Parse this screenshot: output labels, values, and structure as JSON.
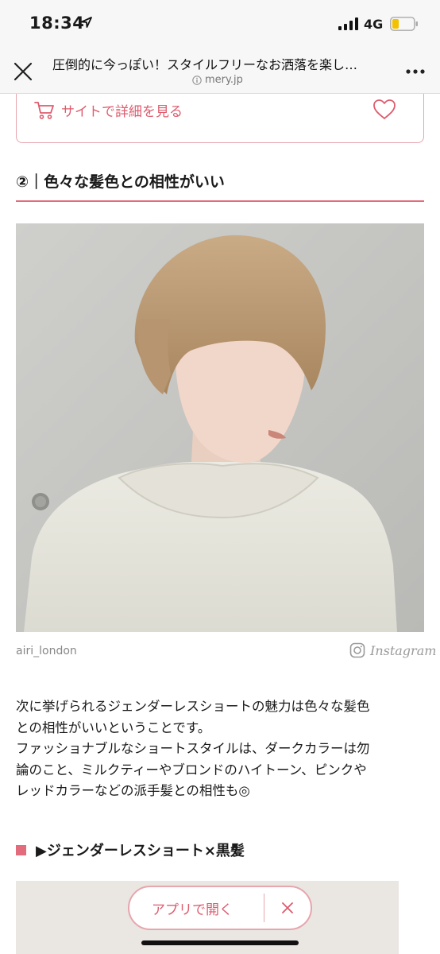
{
  "status_bar": {
    "time": "18:34",
    "network": "4G"
  },
  "browser": {
    "title": "圧倒的に今っぽい！スタイルフリーなお洒落を楽し…",
    "domain": "mery.jp"
  },
  "site_box": {
    "link_label": "サイトで詳細を見る"
  },
  "section": {
    "heading": "②｜色々な髪色との相性がいい"
  },
  "image": {
    "credit": "airi_london",
    "source": "Instagram"
  },
  "paragraph": [
    "次に挙げられるジェンダーレスショートの魅力は色々な髪色",
    "との相性がいいということです。",
    "ファッショナブルなショートスタイルは、ダークカラーは勿",
    "論のこと、ミルクティーやブロンドのハイトーン、ピンクや",
    "レッドカラーなどの派手髪との相性も◎"
  ],
  "sub_heading": "▶ジェンダーレスショート×黒髪",
  "app_banner": {
    "open_label": "アプリで開く"
  },
  "colors": {
    "accent": "#e26b7c",
    "accent_light": "#e7a5ad"
  }
}
